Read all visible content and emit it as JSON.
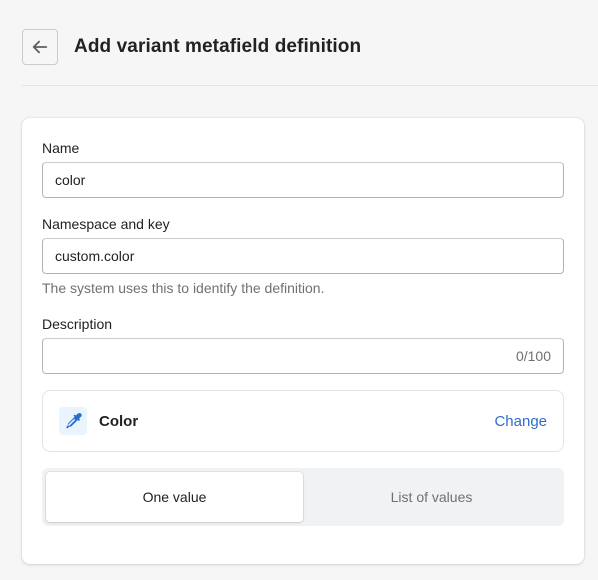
{
  "header": {
    "title": "Add variant metafield definition",
    "back_icon": "arrow-left-icon"
  },
  "form": {
    "name": {
      "label": "Name",
      "value": "color"
    },
    "namespace_key": {
      "label": "Namespace and key",
      "value": "custom.color",
      "help": "The system uses this to identify the definition."
    },
    "description": {
      "label": "Description",
      "value": "",
      "char_count": "0/100"
    }
  },
  "type": {
    "icon": "eyedropper-icon",
    "name": "Color",
    "change_label": "Change"
  },
  "value_mode": {
    "options": [
      "One value",
      "List of values"
    ],
    "selected": "One value"
  },
  "colors": {
    "accent_link": "#2c6ecb",
    "icon_bg": "#eaf4ff"
  }
}
